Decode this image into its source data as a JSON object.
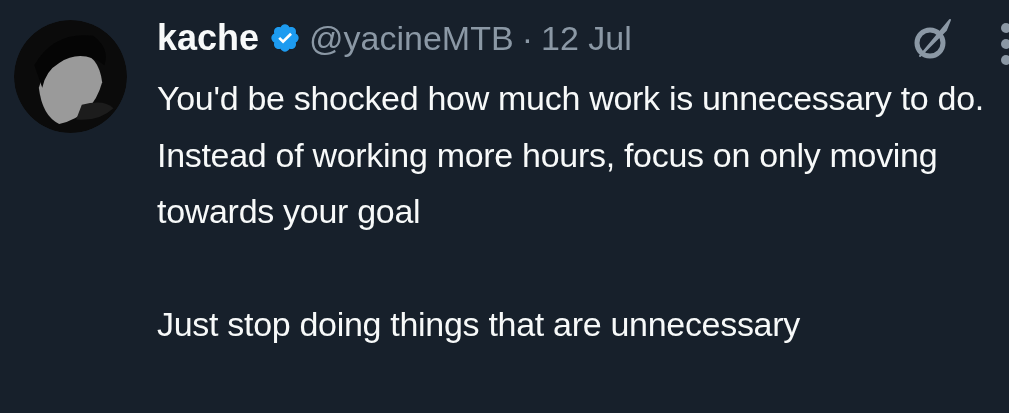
{
  "post": {
    "author": {
      "name": "kache",
      "verified": true,
      "handle": "@yacineMTB",
      "separator": "·",
      "date": "12 Jul"
    },
    "paragraphs": [
      "You'd be shocked how much work is unnecessary to do. Instead of working more hours, focus on only moving towards your goal",
      "Just stop doing things that are unnecessary"
    ]
  }
}
